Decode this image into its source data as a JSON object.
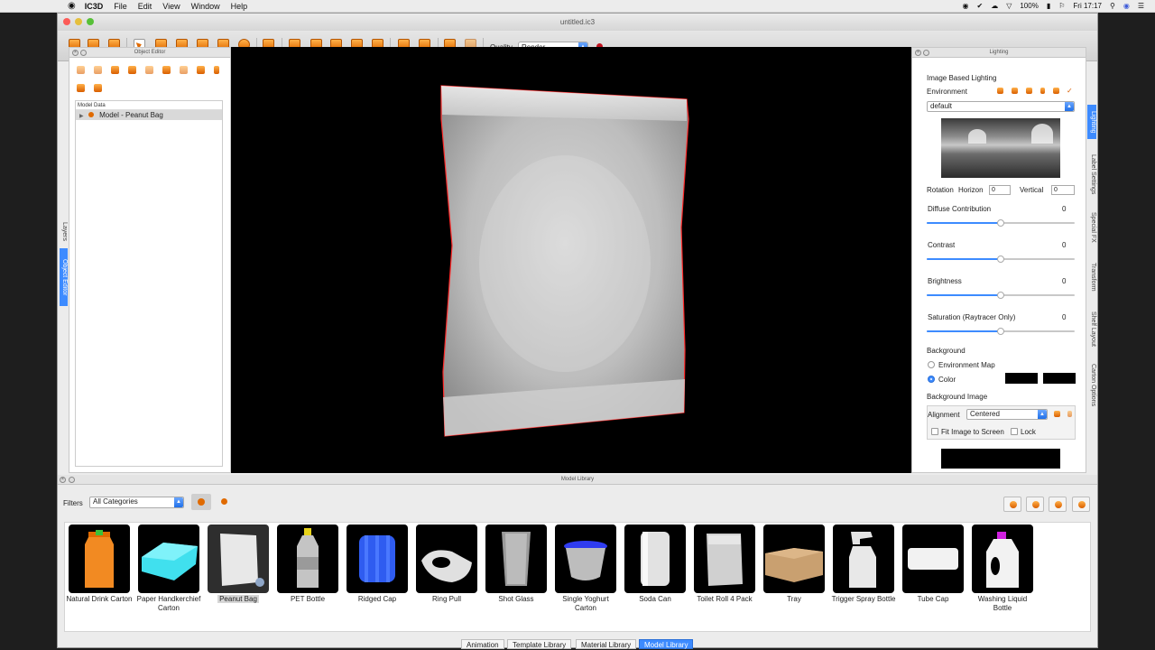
{
  "menubar": {
    "app": "IC3D",
    "items": [
      "File",
      "Edit",
      "View",
      "Window",
      "Help"
    ],
    "battery": "100%",
    "clock": "Fri 17:17"
  },
  "window": {
    "title": "untitled.ic3"
  },
  "toolbar": {
    "quality_label": "Quality",
    "quality_value": "Render"
  },
  "object_editor": {
    "title": "Object Editor",
    "tree_header": "Model Data",
    "tree_item": "Model - Peanut Bag",
    "side_tabs": [
      "Layers",
      "Object Editor"
    ]
  },
  "lighting": {
    "title": "Lighting",
    "section": "Image Based Lighting",
    "environment_label": "Environment",
    "environment_value": "default",
    "rotation_label": "Rotation",
    "horizon_label": "Horizon",
    "horizon_value": "0",
    "vertical_label": "Vertical",
    "vertical_value": "0",
    "sliders": [
      {
        "label": "Diffuse Contribution",
        "value": "0",
        "level": 0.5
      },
      {
        "label": "Contrast",
        "value": "0",
        "level": 0.5
      },
      {
        "label": "Brightness",
        "value": "0",
        "level": 0.5
      },
      {
        "label": "Saturation (Raytracer Only)",
        "value": "0",
        "level": 0.5
      }
    ],
    "background_label": "Background",
    "env_map_label": "Environment Map",
    "color_label": "Color",
    "bg_image_label": "Background Image",
    "alignment_label": "Alignment",
    "alignment_value": "Centered",
    "fit_label": "Fit Image to Screen",
    "lock_label": "Lock",
    "side_tabs": [
      "Lighting",
      "Label Settings",
      "Special FX",
      "Transform",
      "Shelf Layout",
      "Carton Options"
    ]
  },
  "library": {
    "title": "Model Library",
    "filters_label": "Filters",
    "category_value": "All Categories",
    "models": [
      {
        "name": "Natural Drink Carton",
        "icon": "carton-thumbnail"
      },
      {
        "name": "Paper Handkerchief Carton",
        "icon": "tissue-box-thumbnail"
      },
      {
        "name": "Peanut Bag",
        "icon": "bag-thumbnail"
      },
      {
        "name": "PET Bottle",
        "icon": "bottle-thumbnail"
      },
      {
        "name": "Ridged Cap",
        "icon": "cap-thumbnail"
      },
      {
        "name": "Ring Pull",
        "icon": "ring-pull-thumbnail"
      },
      {
        "name": "Shot Glass",
        "icon": "glass-thumbnail"
      },
      {
        "name": "Single Yoghurt Carton",
        "icon": "yoghurt-thumbnail"
      },
      {
        "name": "Soda Can",
        "icon": "can-thumbnail"
      },
      {
        "name": "Toilet Roll 4 Pack",
        "icon": "toilet-roll-thumbnail"
      },
      {
        "name": "Tray",
        "icon": "tray-thumbnail"
      },
      {
        "name": "Trigger Spray Bottle",
        "icon": "spray-bottle-thumbnail"
      },
      {
        "name": "Tube Cap",
        "icon": "tube-cap-thumbnail"
      },
      {
        "name": "Washing Liquid Bottle",
        "icon": "detergent-bottle-thumbnail"
      }
    ],
    "bottom_tabs": [
      "Animation",
      "Template Library",
      "Material Library",
      "Model Library"
    ],
    "active_tab": "Model Library"
  },
  "colors": {
    "accent": "#3d8bff",
    "toolbar_icon": "#f08a16",
    "selection_outline": "#ff2a2a"
  }
}
